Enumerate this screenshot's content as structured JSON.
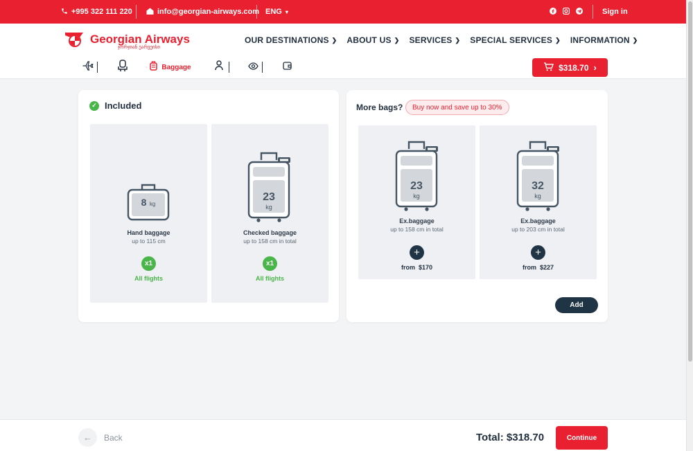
{
  "topbar": {
    "phone": "+995 322 111 220",
    "email": "info@georgian-airways.com",
    "language": "ENG",
    "sign_in": "Sign in",
    "socials": [
      "facebook-icon",
      "instagram-icon",
      "telegram-icon"
    ]
  },
  "header": {
    "brand": "Georgian Airways",
    "brand_sub": "ჯორჯიან ეარვეისი",
    "nav": [
      {
        "label": "OUR DESTINATIONS"
      },
      {
        "label": "ABOUT US"
      },
      {
        "label": "SERVICES"
      },
      {
        "label": "SPECIAL SERVICES"
      },
      {
        "label": "INFORMATION"
      }
    ],
    "steps": [
      {
        "icon": "plane-icon"
      },
      {
        "icon": "seat-icon"
      },
      {
        "icon": "baggage-icon",
        "label": "Baggage",
        "active": true
      },
      {
        "icon": "passenger-icon"
      },
      {
        "icon": "review-icon"
      },
      {
        "icon": "wallet-icon"
      }
    ],
    "cart_amount": "$318.70"
  },
  "included": {
    "title": "Included",
    "bags": [
      {
        "weight": "8",
        "unit": "kg",
        "title": "Hand baggage",
        "size": "up to 115 cm",
        "qty": "x1",
        "note": "All flights"
      },
      {
        "weight": "23",
        "unit": "kg",
        "title": "Checked baggage",
        "size": "up to 158 cm in total",
        "qty": "x1",
        "note": "All flights"
      }
    ]
  },
  "more": {
    "title": "More bags?",
    "promo": "Buy now and save up to 30%",
    "bags": [
      {
        "weight": "23",
        "unit": "kg",
        "title": "Ex.baggage",
        "size": "up to 158 cm in total",
        "from_label": "from",
        "price": "$170"
      },
      {
        "weight": "32",
        "unit": "kg",
        "title": "Ex.baggage",
        "size": "up to 203 cm in total",
        "from_label": "from",
        "price": "$227"
      }
    ],
    "add_label": "Add"
  },
  "footer": {
    "back_label": "Back",
    "total_label": "Total:",
    "total_value": "$318.70",
    "continue_label": "Continue"
  },
  "colors": {
    "brand": "#e8202f",
    "dark": "#1f3445",
    "success": "#4ab54a"
  }
}
